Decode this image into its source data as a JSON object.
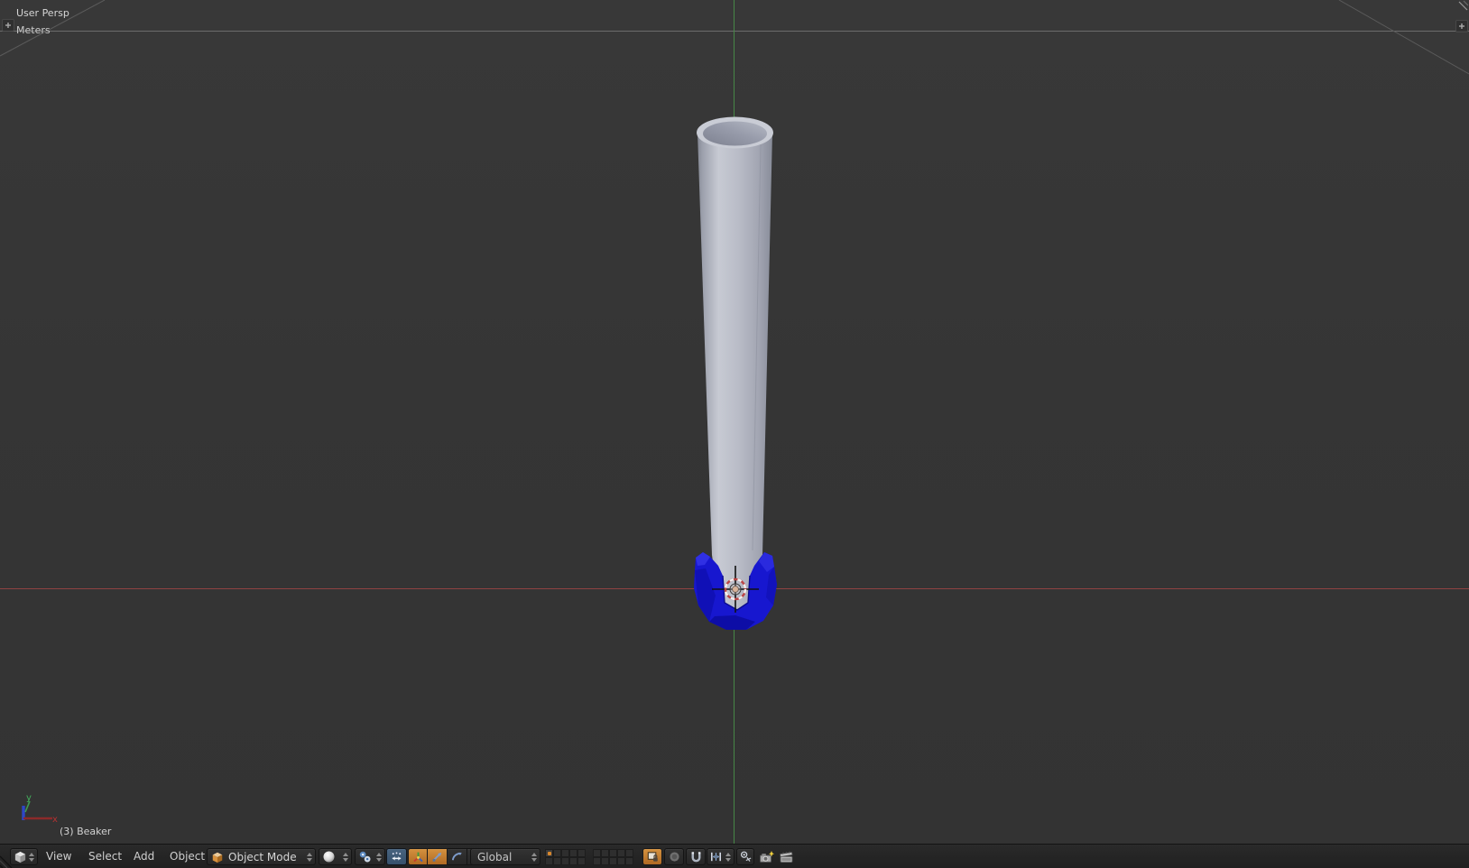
{
  "viewport": {
    "view_name": "User Persp",
    "units": "Meters",
    "selected_object": "(3) Beaker",
    "gizmo": {
      "x_label": "x",
      "y_label": "y"
    },
    "colors": {
      "background": "#353535",
      "axis_green": "#478747",
      "axis_red": "#8e4242",
      "object_body_gray": "#b9bcc7",
      "object_base_blue": "#1717cf",
      "cursor_red": "#bb4444"
    }
  },
  "header": {
    "editor_type": {
      "icon": "viewport-editor-cube-icon"
    },
    "menus": [
      {
        "label": "View"
      },
      {
        "label": "Select"
      },
      {
        "label": "Add"
      },
      {
        "label": "Object"
      }
    ],
    "mode": {
      "value": "Object Mode",
      "icon": "object-mode-cube-icon"
    },
    "shading": {
      "icon": "solid-shading-sphere-icon"
    },
    "pivot": {
      "icon": "median-point-pivot-icon"
    },
    "manipulate_centers": {
      "icon": "manipulate-center-points-icon",
      "enabled": true
    },
    "manipulator": {
      "widget": {
        "icon": "manipulator-axis-icon",
        "enabled": true
      },
      "translate": {
        "icon": "translate-arrow-icon",
        "enabled": true
      },
      "rotate": {
        "icon": "rotate-arc-icon",
        "enabled": false
      },
      "scale": {
        "icon": "scale-arrow-icon",
        "enabled": false
      }
    },
    "orientation": {
      "value": "Global"
    },
    "layers": {
      "groups": 2,
      "cols": 5,
      "rows": 2,
      "active": 0
    },
    "scene_lock": {
      "icon": "lock-to-scene-icon",
      "enabled": true
    },
    "proportional": {
      "icon": "proportional-edit-circle-icon"
    },
    "snap": {
      "icon": "snap-magnet-icon"
    },
    "snap_element": {
      "icon": "snap-increment-icon"
    },
    "snap_target": {
      "icon": "snap-target-icon"
    },
    "opengl_render": {
      "icon": "opengl-render-camera-icon"
    },
    "opengl_anim": {
      "icon": "opengl-render-clapper-icon"
    },
    "accent_orange": "#c5812f"
  }
}
